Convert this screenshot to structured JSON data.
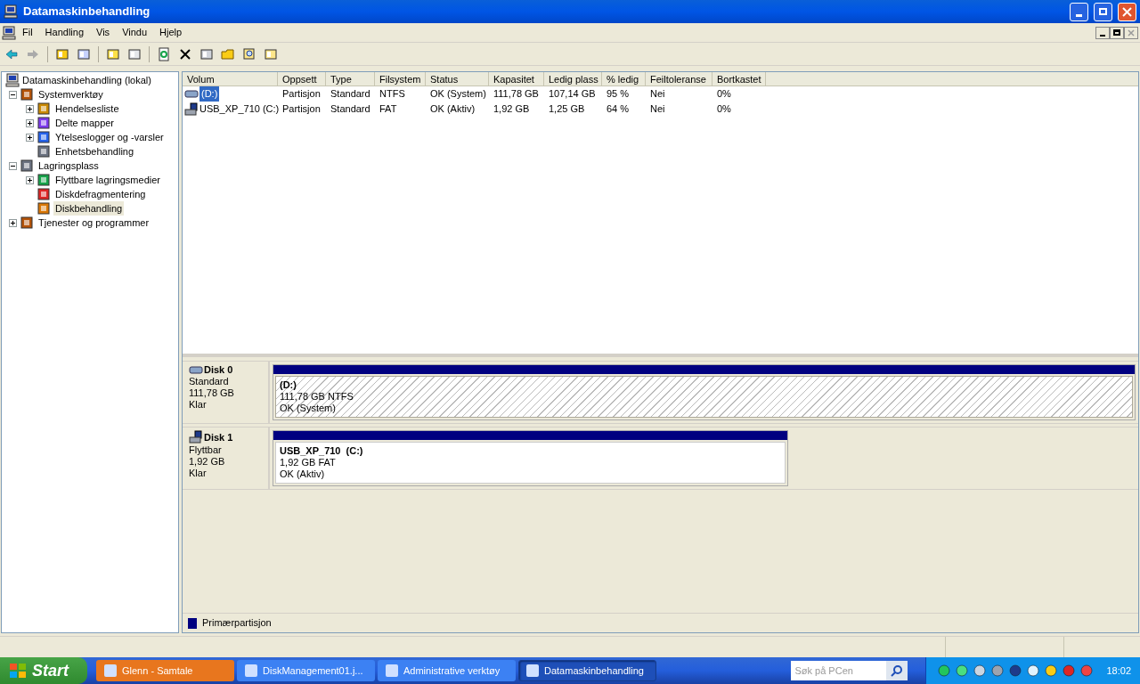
{
  "window": {
    "title": "Datamaskinbehandling"
  },
  "menu": [
    "Fil",
    "Handling",
    "Vis",
    "Vindu",
    "Hjelp"
  ],
  "tree": {
    "label": "Datamaskinbehandling (lokal)",
    "children": [
      {
        "label": "Systemverktøy",
        "kind": "branch",
        "expanded": true,
        "selected": false,
        "children": [
          {
            "label": "Hendelsesliste",
            "kind": "branch",
            "expanded": false,
            "selected": false
          },
          {
            "label": "Delte mapper",
            "kind": "branch",
            "expanded": false,
            "selected": false
          },
          {
            "label": "Ytelseslogger og -varsler",
            "kind": "branch",
            "expanded": false,
            "selected": false
          },
          {
            "label": "Enhetsbehandling",
            "kind": "leaf",
            "selected": false
          }
        ]
      },
      {
        "label": "Lagringsplass",
        "kind": "branch",
        "expanded": true,
        "selected": false,
        "children": [
          {
            "label": "Flyttbare lagringsmedier",
            "kind": "branch",
            "expanded": false,
            "selected": false
          },
          {
            "label": "Diskdefragmentering",
            "kind": "leaf",
            "selected": false
          },
          {
            "label": "Diskbehandling",
            "kind": "leaf",
            "selected": true
          }
        ]
      },
      {
        "label": "Tjenester og programmer",
        "kind": "branch",
        "expanded": false,
        "selected": false
      }
    ]
  },
  "table": {
    "columns": [
      "Volum",
      "Oppsett",
      "Type",
      "Filsystem",
      "Status",
      "Kapasitet",
      "Ledig plass",
      "% ledig",
      "Feiltoleranse",
      "Bortkastet"
    ],
    "rows": [
      {
        "kind": "disk",
        "selected": true,
        "cells": [
          "(D:)",
          "Partisjon",
          "Standard",
          "NTFS",
          "OK (System)",
          "111,78 GB",
          "107,14 GB",
          "95 %",
          "Nei",
          "0%"
        ]
      },
      {
        "kind": "removable",
        "selected": false,
        "cells": [
          "USB_XP_710 (C:)",
          "Partisjon",
          "Standard",
          "FAT",
          "OK (Aktiv)",
          "1,92 GB",
          "1,25 GB",
          "64 %",
          "Nei",
          "0%"
        ]
      }
    ]
  },
  "disks": [
    {
      "name": "Disk 0",
      "kind": "disk",
      "type": "Standard",
      "size": "111,78 GB",
      "status": "Klar",
      "partition": {
        "label": "(D:)",
        "detail": "111,78 GB NTFS",
        "status": "OK (System)",
        "selected": true
      }
    },
    {
      "name": "Disk 1",
      "kind": "removable",
      "type": "Flyttbar",
      "size": "1,92 GB",
      "status": "Klar",
      "partition": {
        "label": "USB_XP_710  (C:)",
        "detail": "1,92 GB FAT",
        "status": "OK (Aktiv)",
        "selected": false
      }
    }
  ],
  "legend": [
    {
      "label": "Primærpartisjon",
      "color": "#000080"
    }
  ],
  "taskbar": {
    "start": "Start",
    "buttons": [
      {
        "label": "Glenn - Samtale",
        "flashing": true,
        "selected": false
      },
      {
        "label": "DiskManagement01.j...",
        "flashing": false,
        "selected": false
      },
      {
        "label": "Administrative verktøy",
        "flashing": false,
        "selected": false
      },
      {
        "label": "Datamaskinbehandling",
        "flashing": false,
        "selected": true
      }
    ],
    "search": {
      "placeholder": "Søk på PCen"
    },
    "clock": "18:02"
  }
}
